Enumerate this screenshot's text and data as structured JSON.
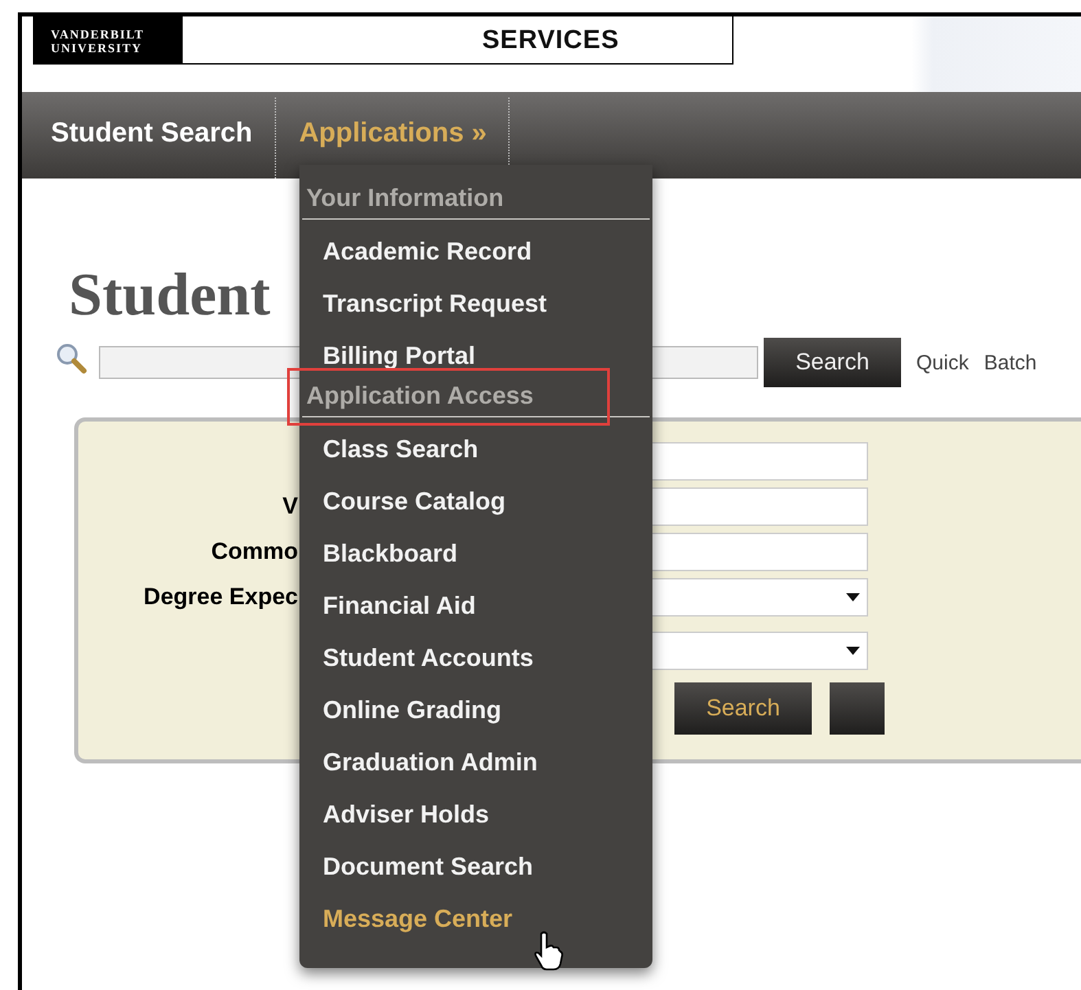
{
  "header": {
    "logo_text": "VANDERBILT UNIVERSITY",
    "banner_text": "SERVICES"
  },
  "nav": [
    {
      "label": "Student Search",
      "selected": false
    },
    {
      "label": "Applications »",
      "selected": true
    }
  ],
  "page_title": "Student",
  "search": {
    "button": "Search",
    "links": [
      "Quick",
      "Batch"
    ]
  },
  "form": {
    "fields": [
      {
        "kind": "text"
      },
      {
        "kind": "text",
        "label": "V"
      },
      {
        "kind": "text",
        "label": "Commo"
      },
      {
        "kind": "select",
        "label": "Degree Expec"
      },
      {
        "kind": "select"
      }
    ],
    "button": "Search"
  },
  "menu": [
    {
      "kind": "header",
      "label": "Your Information",
      "annotated": false
    },
    {
      "kind": "item",
      "label": "Academic Record",
      "hovered": false
    },
    {
      "kind": "item",
      "label": "Transcript Request",
      "hovered": false
    },
    {
      "kind": "item",
      "label": "Billing Portal",
      "hovered": false
    },
    {
      "kind": "header",
      "label": "Application Access",
      "annotated": true
    },
    {
      "kind": "item",
      "label": "Class Search",
      "hovered": false
    },
    {
      "kind": "item",
      "label": "Course Catalog",
      "hovered": false
    },
    {
      "kind": "item",
      "label": "Blackboard",
      "hovered": false
    },
    {
      "kind": "item",
      "label": "Financial Aid",
      "hovered": false
    },
    {
      "kind": "item",
      "label": "Student Accounts",
      "hovered": false
    },
    {
      "kind": "item",
      "label": "Online Grading",
      "hovered": false
    },
    {
      "kind": "item",
      "label": "Graduation Admin",
      "hovered": false
    },
    {
      "kind": "item",
      "label": "Adviser Holds",
      "hovered": false
    },
    {
      "kind": "item",
      "label": "Document Search",
      "hovered": false
    },
    {
      "kind": "item",
      "label": "Message Center",
      "hovered": true
    }
  ]
}
